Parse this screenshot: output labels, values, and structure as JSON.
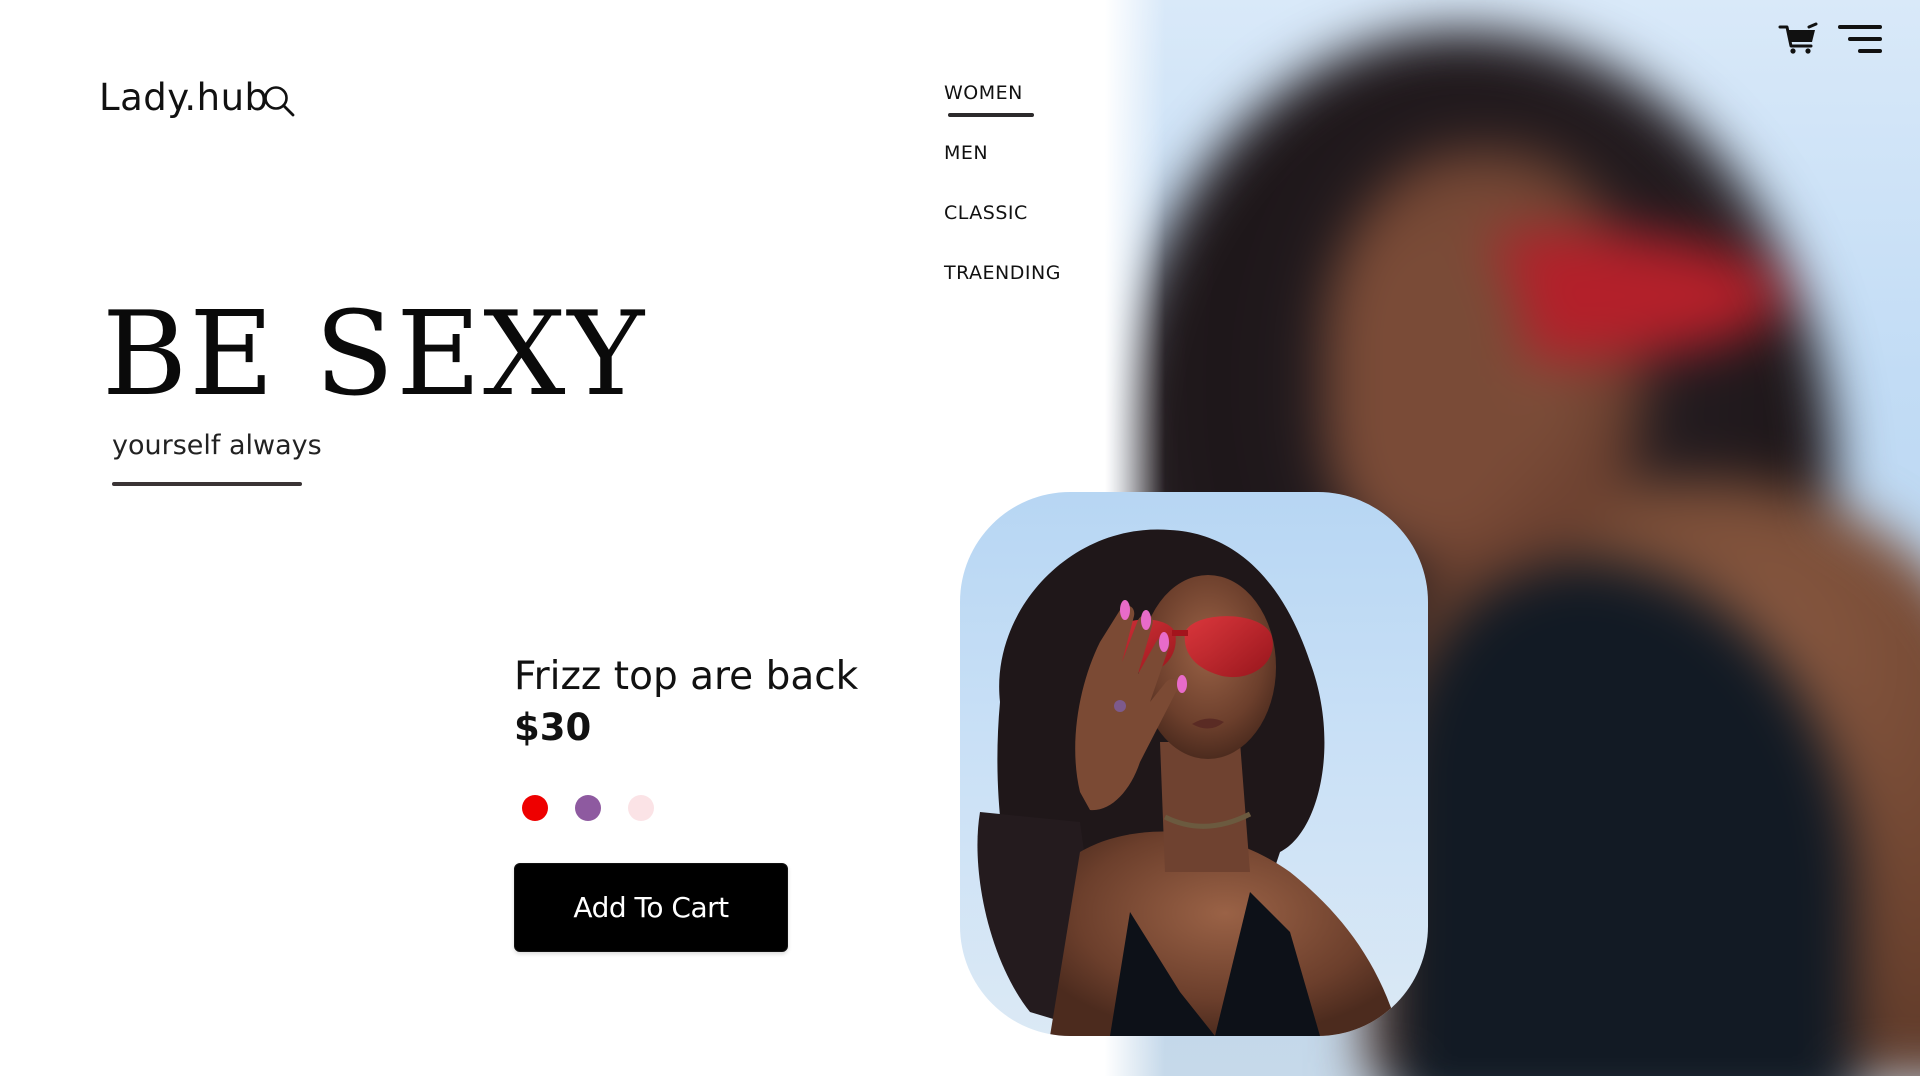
{
  "brand": {
    "name": "Lady.hub"
  },
  "nav": {
    "items": [
      {
        "label": "WOMEN",
        "active": true
      },
      {
        "label": "MEN",
        "active": false
      },
      {
        "label": "CLASSIC",
        "active": false
      },
      {
        "label": "TRAENDING",
        "active": false
      }
    ]
  },
  "hero": {
    "headline": "BE SEXY",
    "tagline": "yourself always"
  },
  "product": {
    "name": "Frizz top are back",
    "price": "$30",
    "swatches": [
      "#ee0000",
      "#8e5aa0",
      "#fbe3e6"
    ],
    "add_to_cart_label": "Add To Cart"
  },
  "icons": {
    "search": "search-icon",
    "cart": "cart-icon",
    "menu": "menu-icon"
  },
  "colors": {
    "background": "#ffffff",
    "text": "#111111",
    "button_bg": "#000000",
    "button_text": "#ffffff"
  }
}
